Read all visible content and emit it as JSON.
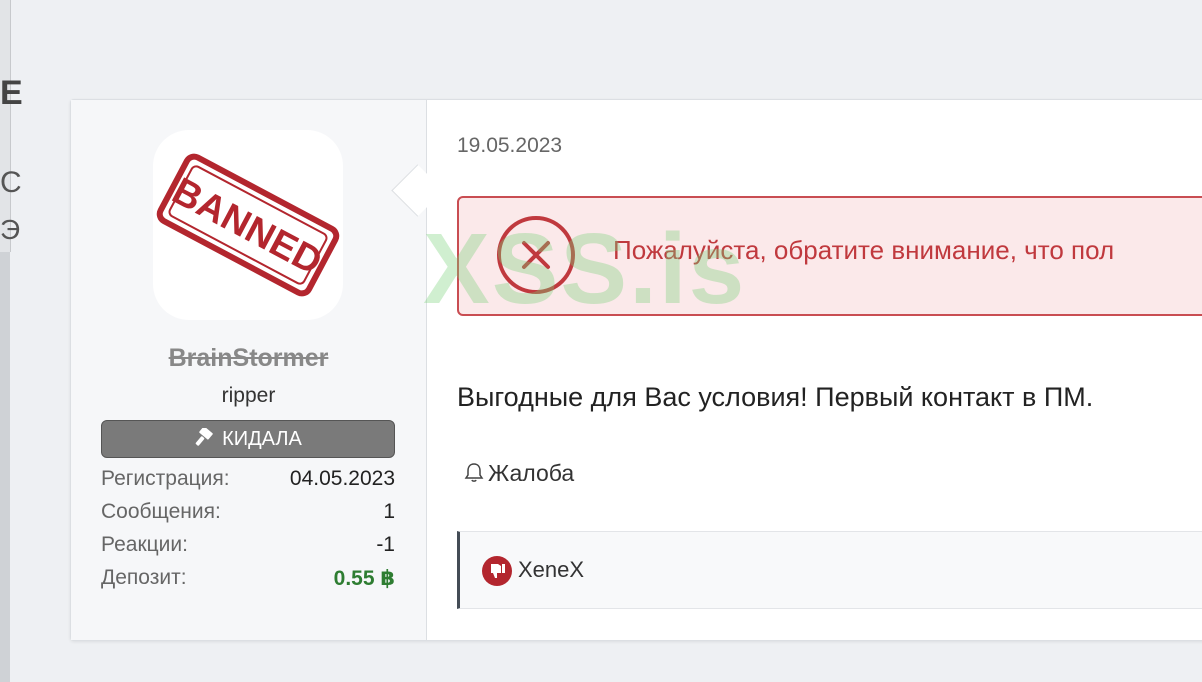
{
  "edge": {
    "glyph_1": "Е",
    "glyph_2": "С",
    "glyph_3": "Э"
  },
  "user": {
    "avatar_stamp": "BANNED",
    "username": "BrainStormer",
    "user_title": "ripper",
    "banner": "КИДАЛА",
    "stats": [
      {
        "label": "Регистрация:",
        "value": "04.05.2023"
      },
      {
        "label": "Сообщения:",
        "value": "1"
      },
      {
        "label": "Реакции:",
        "value": "-1"
      },
      {
        "label": "Депозит:",
        "value": "0.55 ฿"
      }
    ]
  },
  "post": {
    "date": "19.05.2023",
    "notice_text": "Пожалуйста, обратите внимание, что пол",
    "watermark": "XSS.is",
    "message": "Выгодные для Вас условия! Первый контакт в ПМ.",
    "report_label": "Жалоба",
    "reaction_user": "XeneX"
  },
  "colors": {
    "notice_border": "#c94d52",
    "notice_bg": "#fbe9ea",
    "deposit": "#2e7d32",
    "banner_bg": "#7a7a7a"
  }
}
